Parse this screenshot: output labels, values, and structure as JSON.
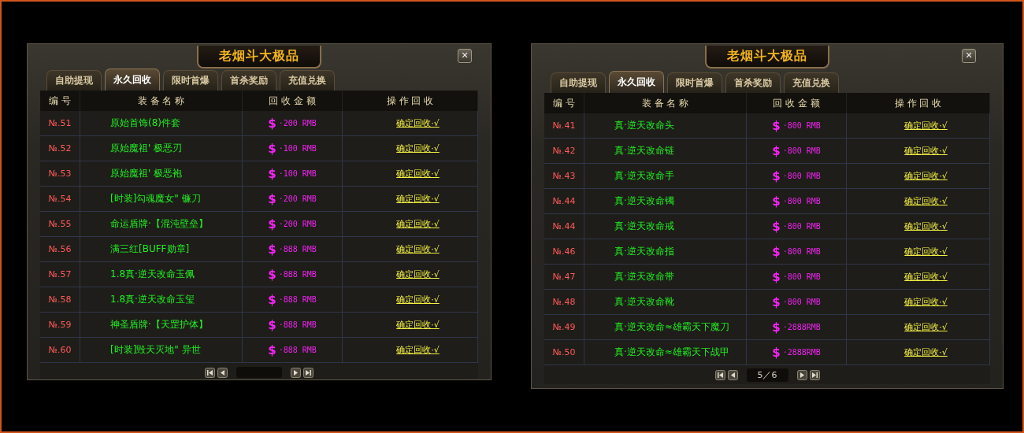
{
  "panels": [
    {
      "title": "老烟斗大极品",
      "close": "✕",
      "tabs": [
        {
          "label": "自助提现",
          "selected": false
        },
        {
          "label": "永久回收",
          "selected": true
        },
        {
          "label": "限时首爆",
          "selected": false
        },
        {
          "label": "首杀奖励",
          "selected": false
        },
        {
          "label": "充值兑换",
          "selected": false
        }
      ],
      "columns": [
        "编 号",
        "装 备 名 称",
        "回 收 金 额",
        "操 作 回 收"
      ],
      "rows": [
        {
          "no": "№.51",
          "name": "原始首饰(8)件套",
          "currency": "$",
          "amount": "·200 RMB",
          "action": "确定回收·√"
        },
        {
          "no": "№.52",
          "name": "原始魔祖' 极恶刃",
          "currency": "$",
          "amount": "·100 RMB",
          "action": "确定回收·√"
        },
        {
          "no": "№.53",
          "name": "原始魔祖' 极恶袍",
          "currency": "$",
          "amount": "·100 RMB",
          "action": "确定回收·√"
        },
        {
          "no": "№.54",
          "name": "[时装]勾魂魔女\" 镰刀",
          "currency": "$",
          "amount": "·200 RMB",
          "action": "确定回收·√"
        },
        {
          "no": "№.55",
          "name": "命运盾牌·【混沌壁垒】",
          "currency": "$",
          "amount": "·200 RMB",
          "action": "确定回收·√"
        },
        {
          "no": "№.56",
          "name": "满三红[BUFF勋章]",
          "currency": "$",
          "amount": "·888 RMB",
          "action": "确定回收·√"
        },
        {
          "no": "№.57",
          "name": "1.8真·逆天改命玉佩",
          "currency": "$",
          "amount": "·888 RMB",
          "action": "确定回收·√"
        },
        {
          "no": "№.58",
          "name": "1.8真·逆天改命玉玺",
          "currency": "$",
          "amount": "·888 RMB",
          "action": "确定回收·√"
        },
        {
          "no": "№.59",
          "name": "神圣盾牌·【天罡护体】",
          "currency": "$",
          "amount": "·888 RMB",
          "action": "确定回收·√"
        },
        {
          "no": "№.60",
          "name": "[时装]毁天灭地\" 异世",
          "currency": "$",
          "amount": "·888 RMB",
          "action": "确定回收·√"
        }
      ]
    },
    {
      "title": "老烟斗大极品",
      "close": "✕",
      "tabs": [
        {
          "label": "自助提现",
          "selected": false
        },
        {
          "label": "永久回收",
          "selected": true
        },
        {
          "label": "限时首爆",
          "selected": false
        },
        {
          "label": "首杀奖励",
          "selected": false
        },
        {
          "label": "充值兑换",
          "selected": false
        }
      ],
      "columns": [
        "编 号",
        "装 备 名 称",
        "回 收 金 额",
        "操 作 回 收"
      ],
      "rows": [
        {
          "no": "№.41",
          "name": "真·逆天改命头",
          "currency": "$",
          "amount": "·800 RMB",
          "action": "确定回收·√"
        },
        {
          "no": "№.42",
          "name": "真·逆天改命链",
          "currency": "$",
          "amount": "·800 RMB",
          "action": "确定回收·√"
        },
        {
          "no": "№.43",
          "name": "真·逆天改命手",
          "currency": "$",
          "amount": "·800 RMB",
          "action": "确定回收·√"
        },
        {
          "no": "№.44",
          "name": "真·逆天改命镯",
          "currency": "$",
          "amount": "·800 RMB",
          "action": "确定回收·√"
        },
        {
          "no": "№.44",
          "name": "真·逆天改命戒",
          "currency": "$",
          "amount": "·800 RMB",
          "action": "确定回收·√"
        },
        {
          "no": "№.46",
          "name": "真·逆天改命指",
          "currency": "$",
          "amount": "·800 RMB",
          "action": "确定回收·√"
        },
        {
          "no": "№.47",
          "name": "真·逆天改命带",
          "currency": "$",
          "amount": "·800 RMB",
          "action": "确定回收·√"
        },
        {
          "no": "№.48",
          "name": "真·逆天改命靴",
          "currency": "$",
          "amount": "·800 RMB",
          "action": "确定回收·√"
        },
        {
          "no": "№.49",
          "name": "真·逆天改命≈雄霸天下魔刀",
          "currency": "$",
          "amount": "·2888RMB",
          "action": "确定回收·√"
        },
        {
          "no": "№.50",
          "name": "真·逆天改命≈雄霸天下战甲",
          "currency": "$",
          "amount": "·2888RMB",
          "action": "确定回收·√"
        }
      ],
      "pager": {
        "page": "5／6"
      }
    }
  ]
}
